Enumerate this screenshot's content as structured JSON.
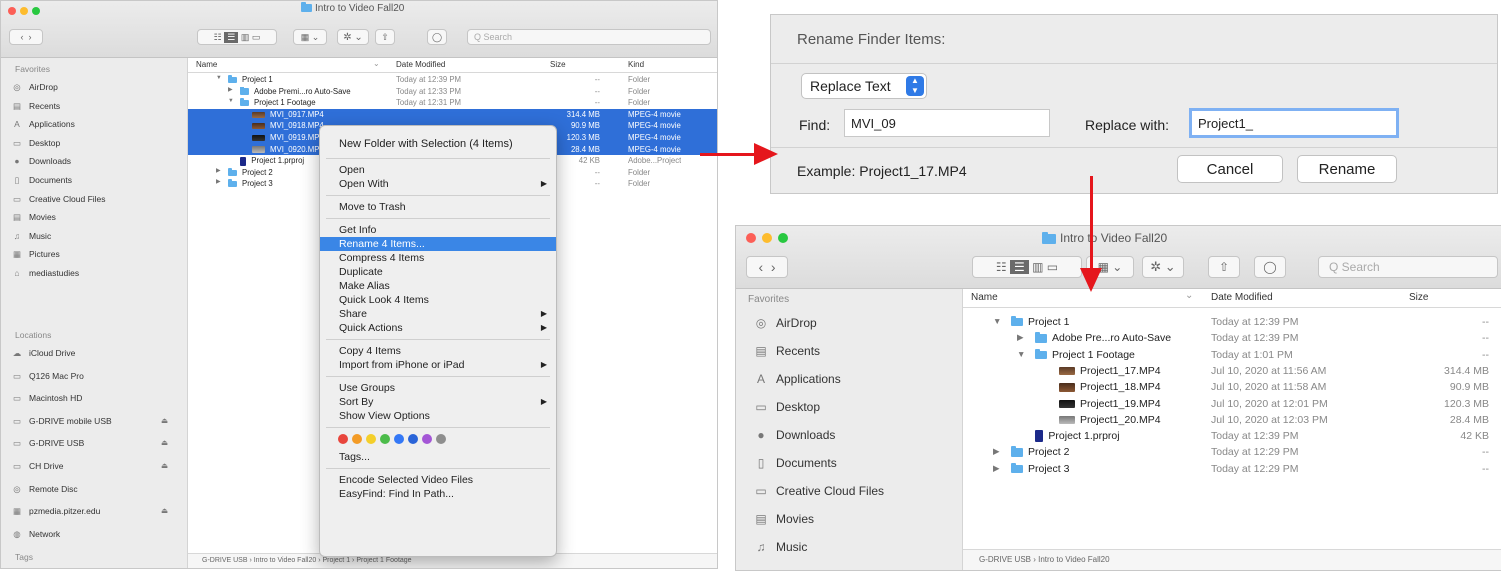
{
  "finder_left": {
    "title": "Intro to Video Fall20",
    "search_placeholder": "Q Search",
    "sidebar": {
      "favorites_label": "Favorites",
      "favorites": [
        {
          "icon": "airdrop-icon",
          "glyph": "◎",
          "label": "AirDrop"
        },
        {
          "icon": "recents-icon",
          "glyph": "▤",
          "label": "Recents"
        },
        {
          "icon": "applications-icon",
          "glyph": "A",
          "label": "Applications"
        },
        {
          "icon": "desktop-icon",
          "glyph": "▭",
          "label": "Desktop"
        },
        {
          "icon": "downloads-icon",
          "glyph": "●",
          "label": "Downloads"
        },
        {
          "icon": "documents-icon",
          "glyph": "▯",
          "label": "Documents"
        },
        {
          "icon": "folder-icon",
          "glyph": "▭",
          "label": "Creative Cloud Files"
        },
        {
          "icon": "movies-icon",
          "glyph": "▤",
          "label": "Movies"
        },
        {
          "icon": "music-icon",
          "glyph": "♫",
          "label": "Music"
        },
        {
          "icon": "pictures-icon",
          "glyph": "▦",
          "label": "Pictures"
        },
        {
          "icon": "home-icon",
          "glyph": "⌂",
          "label": "mediastudies"
        }
      ],
      "locations_label": "Locations",
      "locations": [
        {
          "icon": "icloud-icon",
          "glyph": "☁",
          "label": "iCloud Drive",
          "eject": ""
        },
        {
          "icon": "computer-icon",
          "glyph": "▭",
          "label": "Q126 Mac Pro",
          "eject": ""
        },
        {
          "icon": "disk-icon",
          "glyph": "▭",
          "label": "Macintosh HD",
          "eject": ""
        },
        {
          "icon": "disk-icon",
          "glyph": "▭",
          "label": "G-DRIVE mobile USB",
          "eject": "⏏"
        },
        {
          "icon": "disk-icon",
          "glyph": "▭",
          "label": "G-DRIVE USB",
          "eject": "⏏"
        },
        {
          "icon": "disk-icon",
          "glyph": "▭",
          "label": "CH Drive",
          "eject": "⏏"
        },
        {
          "icon": "disc-icon",
          "glyph": "◎",
          "label": "Remote Disc",
          "eject": ""
        },
        {
          "icon": "server-icon",
          "glyph": "▦",
          "label": "pzmedia.pitzer.edu",
          "eject": "⏏"
        },
        {
          "icon": "network-icon",
          "glyph": "◍",
          "label": "Network",
          "eject": ""
        }
      ],
      "tags_label": "Tags"
    },
    "columns": {
      "name": "Name",
      "date": "Date Modified",
      "size": "Size",
      "kind": "Kind"
    },
    "rows": [
      {
        "level": 0,
        "tri": "▼",
        "icon": "folder",
        "name": "Project 1",
        "date": "Today at 12:39 PM",
        "size": "--",
        "kind": "Folder",
        "sel": false
      },
      {
        "level": 1,
        "tri": "▶",
        "icon": "folder",
        "name": "Adobe Premi...ro Auto-Save",
        "date": "Today at 12:33 PM",
        "size": "--",
        "kind": "Folder",
        "sel": false
      },
      {
        "level": 1,
        "tri": "▼",
        "icon": "folder",
        "name": "Project 1 Footage",
        "date": "Today at 12:31 PM",
        "size": "--",
        "kind": "Folder",
        "sel": false
      },
      {
        "level": 2,
        "tri": "",
        "icon": "thumb1",
        "name": "MVI_0917.MP4",
        "date": "",
        "size": "314.4 MB",
        "kind": "MPEG-4 movie",
        "sel": true
      },
      {
        "level": 2,
        "tri": "",
        "icon": "thumb2",
        "name": "MVI_0918.MP4",
        "date": "",
        "size": "90.9 MB",
        "kind": "MPEG-4 movie",
        "sel": true
      },
      {
        "level": 2,
        "tri": "",
        "icon": "thumb3",
        "name": "MVI_0919.MP4",
        "date": "",
        "size": "120.3 MB",
        "kind": "MPEG-4 movie",
        "sel": true
      },
      {
        "level": 2,
        "tri": "",
        "icon": "thumb4",
        "name": "MVI_0920.MP4",
        "date": "",
        "size": "28.4 MB",
        "kind": "MPEG-4 movie",
        "sel": true
      },
      {
        "level": 1,
        "tri": "",
        "icon": "doc",
        "name": "Project 1.prproj",
        "date": "",
        "size": "42 KB",
        "kind": "Adobe...Project",
        "sel": false
      },
      {
        "level": 0,
        "tri": "▶",
        "icon": "folder",
        "name": "Project 2",
        "date": "",
        "size": "--",
        "kind": "Folder",
        "sel": false
      },
      {
        "level": 0,
        "tri": "▶",
        "icon": "folder",
        "name": "Project 3",
        "date": "",
        "size": "--",
        "kind": "Folder",
        "sel": false
      }
    ],
    "pathbar": "G-DRIVE USB › Intro to Video Fall20 › Project 1 › Project 1 Footage"
  },
  "context_menu": {
    "items": [
      {
        "label": "New Folder with Selection (4 Items)",
        "sub": false,
        "hl": false,
        "bold": true
      },
      {
        "sep": true
      },
      {
        "label": "Open",
        "sub": false,
        "hl": false
      },
      {
        "label": "Open With",
        "sub": true,
        "hl": false
      },
      {
        "sep": true
      },
      {
        "label": "Move to Trash",
        "sub": false,
        "hl": false
      },
      {
        "sep": true
      },
      {
        "label": "Get Info",
        "sub": false,
        "hl": false
      },
      {
        "label": "Rename 4 Items...",
        "sub": false,
        "hl": true
      },
      {
        "label": "Compress 4 Items",
        "sub": false,
        "hl": false
      },
      {
        "label": "Duplicate",
        "sub": false,
        "hl": false
      },
      {
        "label": "Make Alias",
        "sub": false,
        "hl": false
      },
      {
        "label": "Quick Look 4 Items",
        "sub": false,
        "hl": false
      },
      {
        "label": "Share",
        "sub": true,
        "hl": false
      },
      {
        "label": "Quick Actions",
        "sub": true,
        "hl": false
      },
      {
        "sep": true
      },
      {
        "label": "Copy 4 Items",
        "sub": false,
        "hl": false
      },
      {
        "label": "Import from iPhone or iPad",
        "sub": true,
        "hl": false
      },
      {
        "sep": true
      },
      {
        "label": "Use Groups",
        "sub": false,
        "hl": false
      },
      {
        "label": "Sort By",
        "sub": true,
        "hl": false
      },
      {
        "label": "Show View Options",
        "sub": false,
        "hl": false
      },
      {
        "sep": true
      },
      {
        "tags": true
      },
      {
        "label": "Tags...",
        "sub": false,
        "hl": false
      },
      {
        "sep": true
      },
      {
        "label": "Encode Selected Video Files",
        "sub": false,
        "hl": false
      },
      {
        "label": "EasyFind: Find In Path...",
        "sub": false,
        "hl": false
      }
    ],
    "tag_colors": [
      "#e8453c",
      "#f39b26",
      "#f4cf2a",
      "#4cbc4a",
      "#3478f6",
      "#2a64d8",
      "#a456d6",
      "#8e8e8e"
    ]
  },
  "rename_dialog": {
    "title": "Rename Finder Items:",
    "mode": "Replace Text",
    "find_label": "Find:",
    "find_value": "MVI_09",
    "replace_label": "Replace with:",
    "replace_value": "Project1_",
    "example": "Example: Project1_17.MP4",
    "cancel": "Cancel",
    "rename": "Rename"
  },
  "finder_right": {
    "title": "Intro to Video Fall20",
    "search_placeholder": "Q Search",
    "sidebar": {
      "favorites_label": "Favorites",
      "favorites": [
        {
          "icon": "airdrop-icon",
          "glyph": "◎",
          "label": "AirDrop"
        },
        {
          "icon": "recents-icon",
          "glyph": "▤",
          "label": "Recents"
        },
        {
          "icon": "applications-icon",
          "glyph": "A",
          "label": "Applications"
        },
        {
          "icon": "desktop-icon",
          "glyph": "▭",
          "label": "Desktop"
        },
        {
          "icon": "downloads-icon",
          "glyph": "●",
          "label": "Downloads"
        },
        {
          "icon": "documents-icon",
          "glyph": "▯",
          "label": "Documents"
        },
        {
          "icon": "folder-icon",
          "glyph": "▭",
          "label": "Creative Cloud Files"
        },
        {
          "icon": "movies-icon",
          "glyph": "▤",
          "label": "Movies"
        },
        {
          "icon": "music-icon",
          "glyph": "♫",
          "label": "Music"
        }
      ]
    },
    "columns": {
      "name": "Name",
      "date": "Date Modified",
      "size": "Size"
    },
    "rows": [
      {
        "level": 0,
        "tri": "▼",
        "icon": "folder",
        "name": "Project 1",
        "date": "Today at 12:39 PM",
        "size": "--"
      },
      {
        "level": 1,
        "tri": "▶",
        "icon": "folder",
        "name": "Adobe Pre...ro Auto-Save",
        "date": "Today at 12:39 PM",
        "size": "--"
      },
      {
        "level": 1,
        "tri": "▼",
        "icon": "folder",
        "name": "Project 1 Footage",
        "date": "Today at 1:01 PM",
        "size": "--"
      },
      {
        "level": 2,
        "tri": "",
        "icon": "thumb1",
        "name": "Project1_17.MP4",
        "date": "Jul 10, 2020 at 11:56 AM",
        "size": "314.4 MB"
      },
      {
        "level": 2,
        "tri": "",
        "icon": "thumb2",
        "name": "Project1_18.MP4",
        "date": "Jul 10, 2020 at 11:58 AM",
        "size": "90.9 MB"
      },
      {
        "level": 2,
        "tri": "",
        "icon": "thumb3",
        "name": "Project1_19.MP4",
        "date": "Jul 10, 2020 at 12:01 PM",
        "size": "120.3 MB"
      },
      {
        "level": 2,
        "tri": "",
        "icon": "thumb4",
        "name": "Project1_20.MP4",
        "date": "Jul 10, 2020 at 12:03 PM",
        "size": "28.4 MB"
      },
      {
        "level": 1,
        "tri": "",
        "icon": "doc",
        "name": "Project 1.prproj",
        "date": "Today at 12:39 PM",
        "size": "42 KB"
      },
      {
        "level": 0,
        "tri": "▶",
        "icon": "folder",
        "name": "Project 2",
        "date": "Today at 12:29 PM",
        "size": "--"
      },
      {
        "level": 0,
        "tri": "▶",
        "icon": "folder",
        "name": "Project 3",
        "date": "Today at 12:29 PM",
        "size": "--"
      }
    ],
    "pathbar": "G-DRIVE USB › Intro to Video Fall20"
  },
  "colors": {
    "selection": "#2f6fd8",
    "arrow": "#e5161c",
    "highlight": "#3a86e6",
    "folder": "#5eb0ec"
  }
}
